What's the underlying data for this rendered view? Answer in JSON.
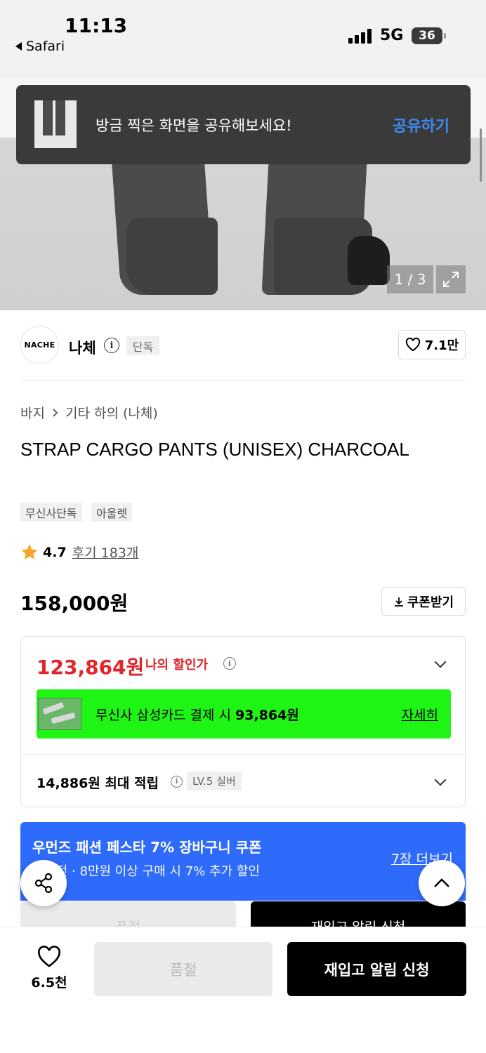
{
  "status_bar": {
    "time": "11:13",
    "back_app": "Safari",
    "network": "5G",
    "battery": "36"
  },
  "gallery": {
    "counter": "1 / 3"
  },
  "share_toast": {
    "message": "방금 찍은 화면을 공유해보세요!",
    "action": "공유하기"
  },
  "brand": {
    "logo_text": "NACHE",
    "name": "나체",
    "badge": "단독",
    "like_count": "7.1만"
  },
  "product": {
    "breadcrumb": [
      "바지",
      "기타 하의 (나체)"
    ],
    "title": "STRAP CARGO PANTS (UNISEX) CHARCOAL",
    "tags": [
      "무신사단독",
      "아울렛"
    ],
    "rating": "4.7",
    "reviews": "후기 183개",
    "price": "158,000원",
    "coupon_label": "쿠폰받기"
  },
  "discount": {
    "my_price": "123,864원",
    "my_price_label": "나의 할인가",
    "card_text": "무신사 삼성카드 결제 시",
    "card_price": "93,864원",
    "card_detail": "자세히",
    "points": "14,886원 최대 적립",
    "level": "LV.5 실버"
  },
  "fest_banner": {
    "title": "우먼즈 패션 페스타 7% 장바구니 쿠폰",
    "subtitle": "7일 전 · 8만원 이상 구매 시 7% 추가 할인",
    "more": "7장 더보기"
  },
  "bottom_bar": {
    "wish_count": "6.5천",
    "sold_out": "품절",
    "notify": "재입고 알림 신청"
  },
  "colors": {
    "sale_red": "#e0262b",
    "card_green": "#1ff514",
    "banner_blue": "#2f6bfb",
    "toast_link": "#3d8bf2",
    "star": "#f5a623"
  }
}
